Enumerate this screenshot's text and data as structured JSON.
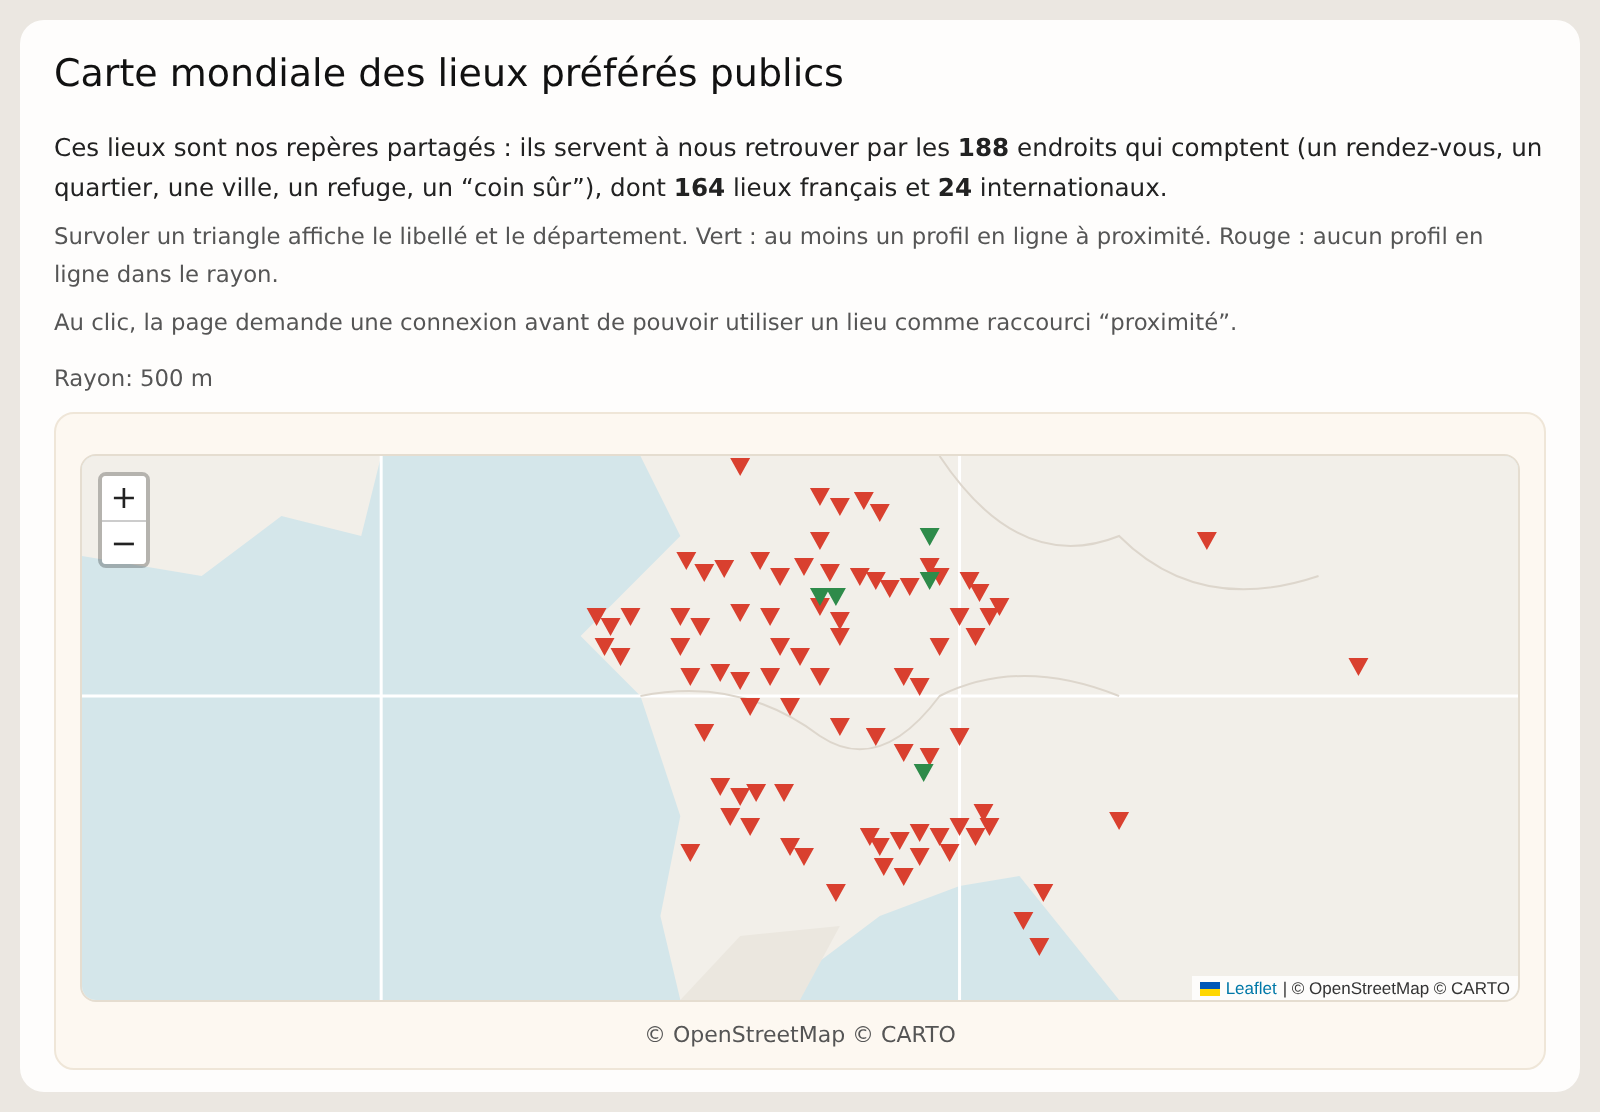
{
  "title": "Carte mondiale des lieux préférés publics",
  "intro": "Ces lieux sont nos repères partagés : ils servent à nous retrouver par les **188** endroits qui comptent (un rendez-vous, un quartier, une ville, un refuge, un “coin sûr”), dont **164** lieux français et **24** internationaux.",
  "hints": [
    "Survoler un triangle affiche le libellé et le département. Vert : au moins un profil en ligne à proximité. Rouge : aucun profil en ligne dans le rayon.",
    "Au clic, la page demande une connexion avant de pouvoir utiliser un lieu comme raccourci “proximité”."
  ],
  "radius": "Rayon: 500 m",
  "map": {
    "kind": "picture",
    "zoom_in": "+",
    "zoom_out": "−",
    "attribution_link": "Leaflet",
    "attribution_text": "| © OpenStreetMap © CARTO"
  },
  "caption": "© OpenStreetMap © CARTO"
}
